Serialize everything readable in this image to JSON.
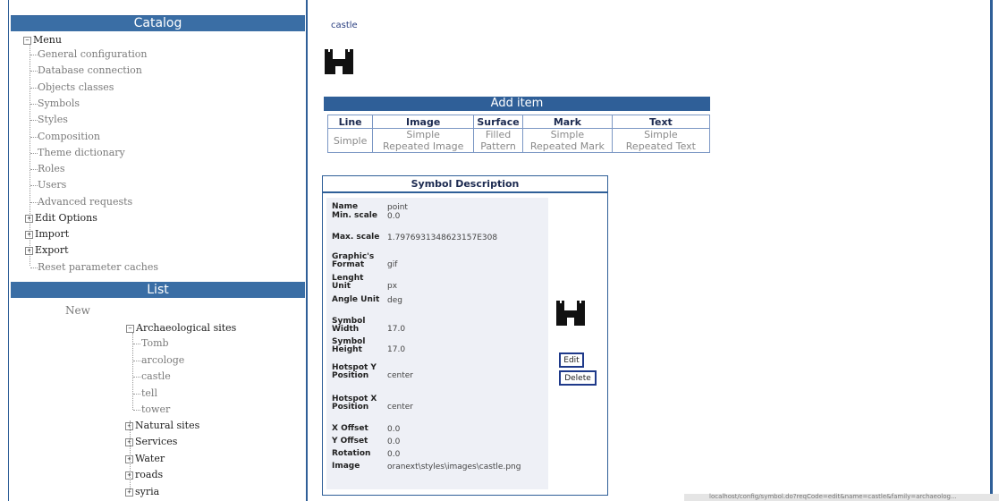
{
  "catalog": {
    "title": "Catalog",
    "root_label": "Menu",
    "items": [
      {
        "label": "General configuration"
      },
      {
        "label": "Database connection"
      },
      {
        "label": "Objects classes"
      },
      {
        "label": "Symbols"
      },
      {
        "label": "Styles"
      },
      {
        "label": "Composition"
      },
      {
        "label": "Theme dictionary"
      },
      {
        "label": "Roles"
      },
      {
        "label": "Users"
      },
      {
        "label": "Advanced requests"
      }
    ],
    "groups": [
      {
        "label": "Edit Options"
      },
      {
        "label": "Import"
      },
      {
        "label": "Export"
      }
    ],
    "reset_label": "Reset parameter caches"
  },
  "list": {
    "title": "List",
    "new_label": "New",
    "archaeological": {
      "label": "Archaeological sites",
      "children": [
        "Tomb",
        "arcologe",
        "castle",
        "tell",
        "tower"
      ]
    },
    "others": [
      "Natural sites",
      "Services",
      "Water",
      "roads",
      "syria"
    ]
  },
  "symbol": {
    "name": "castle"
  },
  "add_item": {
    "title": "Add item",
    "headers": [
      "Line",
      "Image",
      "Surface",
      "Mark",
      "Text"
    ],
    "cells": [
      [
        "Simple"
      ],
      [
        "Simple",
        "Repeated Image"
      ],
      [
        "Filled",
        "Pattern"
      ],
      [
        "Simple",
        "Repeated Mark"
      ],
      [
        "Simple",
        "Repeated Text"
      ]
    ]
  },
  "symbol_description": {
    "title": "Symbol Description",
    "fields": [
      {
        "label": "Name",
        "value": "point"
      },
      {
        "label": "Min. scale",
        "value": "0.0"
      },
      {
        "label": "Max. scale",
        "value": "1.7976931348623157E308"
      },
      {
        "label": "Graphic's Format",
        "value": "gif"
      },
      {
        "label": "Lenght Unit",
        "value": "px"
      },
      {
        "label": "Angle Unit",
        "value": "deg"
      },
      {
        "label": "Symbol Width",
        "value": "17.0"
      },
      {
        "label": "Symbol Height",
        "value": "17.0"
      },
      {
        "label": "Hotspot Y Position",
        "value": "center"
      },
      {
        "label": "Hotspot X Position",
        "value": "center"
      },
      {
        "label": "X Offset",
        "value": "0.0"
      },
      {
        "label": "Y Offset",
        "value": "0.0"
      },
      {
        "label": "Rotation",
        "value": "0.0"
      },
      {
        "label": "Image",
        "value": "oranext\\styles\\images\\castle.png"
      }
    ],
    "edit_label": "Edit",
    "delete_label": "Delete"
  },
  "status": {
    "url": "localhost/config/symbol.do?reqCode=edit&name=castle&family=archaeolog..."
  },
  "colors": {
    "accent": "#2f5f98",
    "header": "#3a6ea5"
  }
}
